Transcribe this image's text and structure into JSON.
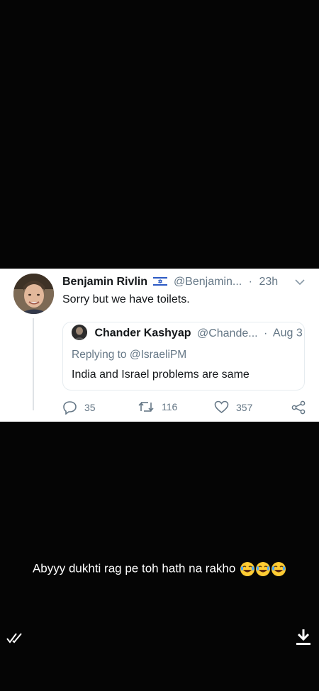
{
  "tweet": {
    "author_name": "Benjamin Rivlin",
    "handle": "@Benjamin...",
    "separator": "·",
    "time": "23h",
    "text": "Sorry but we have toilets.",
    "quoted": {
      "author_name": "Chander Kashyap",
      "handle": "@Chande...",
      "separator": "·",
      "date": "Aug 3",
      "replying_to": "Replying to @IsraeliPM",
      "text": "India and Israel problems are same"
    },
    "actions": {
      "replies": "35",
      "retweets": "116",
      "likes": "357"
    }
  },
  "caption": {
    "text": "Abyyy dukhti rag pe toh hath na rakho"
  },
  "colors": {
    "background": "#050505",
    "card": "#ffffff",
    "primary_text": "#14171a",
    "secondary_text": "#657786",
    "flag_blue": "#2b59c3"
  },
  "icons": [
    "chevron-down-icon",
    "israel-flag-icon",
    "reply-icon",
    "retweet-icon",
    "like-icon",
    "share-icon",
    "laughing-emoji-icon",
    "double-check-icon",
    "download-icon"
  ]
}
